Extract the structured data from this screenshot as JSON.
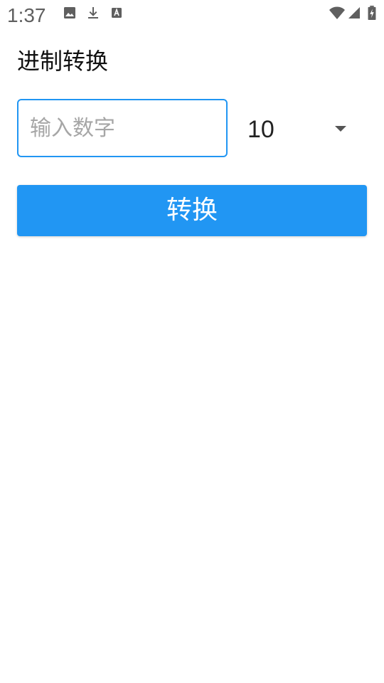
{
  "status_bar": {
    "time": "1:37",
    "icons": [
      "image-icon",
      "download-icon",
      "a-notification-icon",
      "wifi-icon",
      "signal-icon",
      "battery-icon"
    ]
  },
  "page": {
    "title": "进制转换"
  },
  "input": {
    "placeholder": "输入数字",
    "value": ""
  },
  "base_select": {
    "selected": "10"
  },
  "convert_button": {
    "label": "转换"
  },
  "colors": {
    "accent": "#2196F3",
    "status_icon": "#5f5f5f",
    "text": "#111111",
    "placeholder": "#a6a6a6"
  }
}
